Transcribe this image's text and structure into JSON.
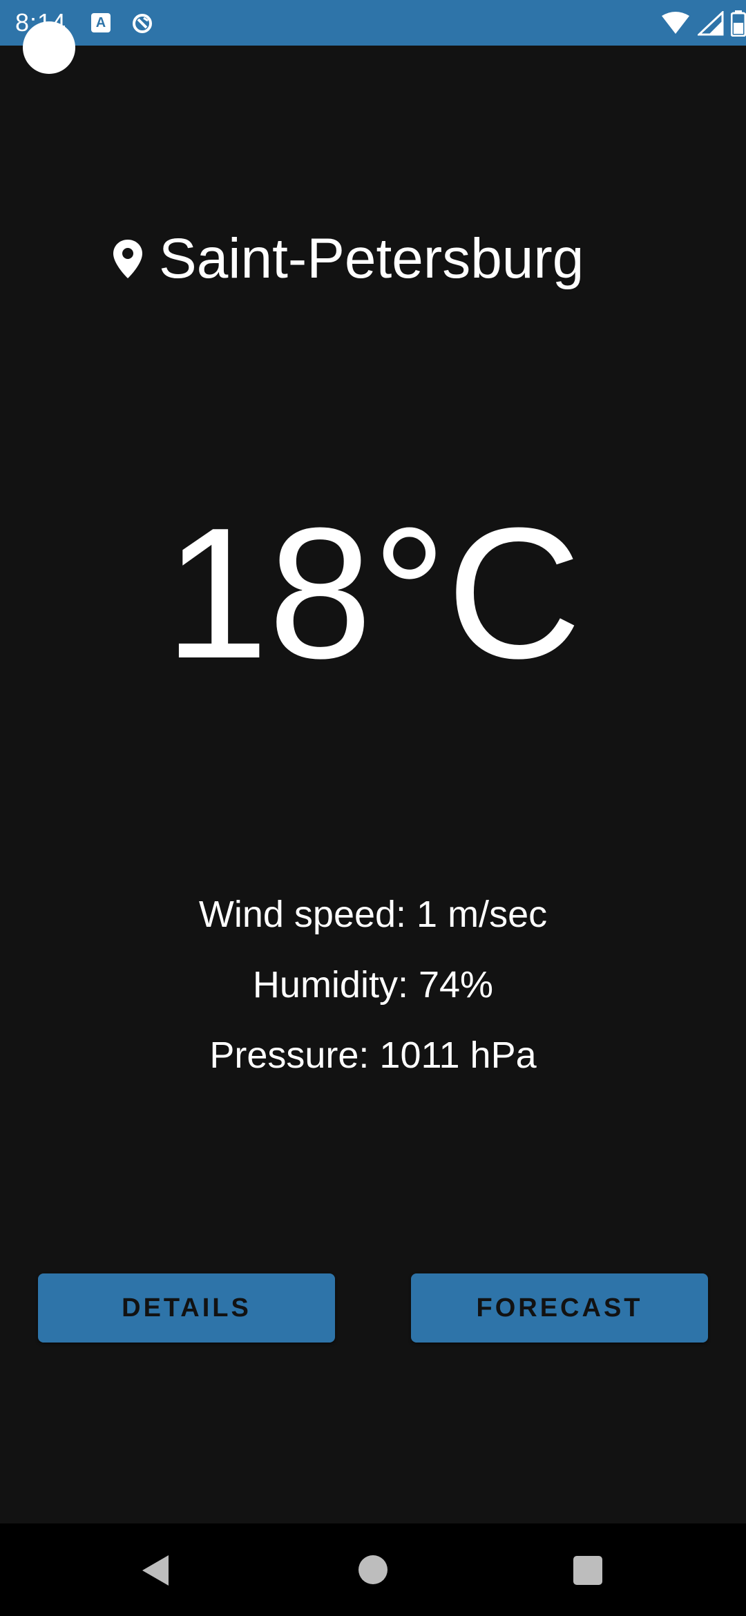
{
  "status_bar": {
    "time": "8:14",
    "notification_icon_a_label": "A",
    "icons": [
      "a-notification-icon",
      "sync-icon",
      "wifi-icon",
      "signal-icon",
      "battery-icon"
    ]
  },
  "weather": {
    "location_icon": "location-pin-icon",
    "city": "Saint-Petersburg",
    "temperature": "18°C",
    "wind": "Wind speed: 1 m/sec",
    "humidity": "Humidity: 74%",
    "pressure": "Pressure: 1011 hPa"
  },
  "buttons": {
    "details": "DETAILS",
    "forecast": "FORECAST"
  },
  "navigation": {
    "icons": [
      "back-icon",
      "home-icon",
      "recents-icon"
    ]
  },
  "colors": {
    "background": "#121212",
    "accent": "#2e74a9",
    "text": "#ffffff",
    "button_text": "#121212",
    "nav_bar": "#000000",
    "nav_icons": "#bdbdbd"
  }
}
